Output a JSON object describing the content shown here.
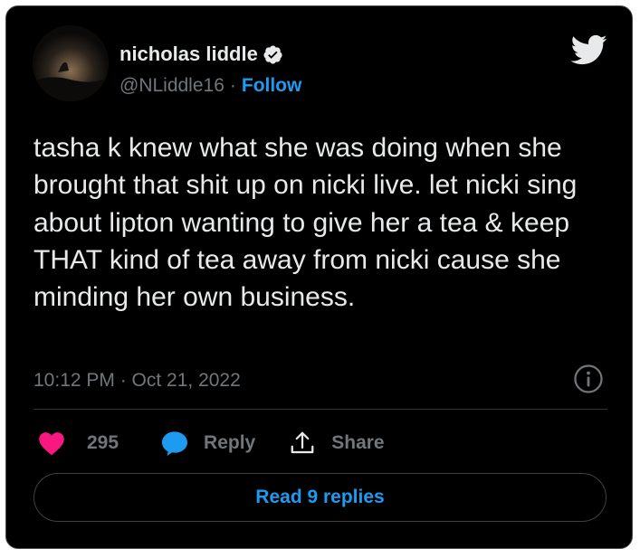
{
  "author": {
    "display_name": "nicholas liddle",
    "handle": "@NLiddle16",
    "separator": "·",
    "follow_label": "Follow",
    "verified": true
  },
  "tweet": {
    "text": "tasha k knew what she was doing when she brought that shit up on nicki live. let nicki sing about lipton wanting to give her a tea & keep THAT kind of tea away from nicki cause she minding her own business.",
    "timestamp": "10:12 PM · Oct 21, 2022"
  },
  "actions": {
    "like_count": "295",
    "reply_label": "Reply",
    "share_label": "Share"
  },
  "read_replies_label": "Read 9 replies",
  "icons": {
    "logo": "twitter-bird-icon",
    "verified": "verified-badge-icon",
    "info": "info-icon",
    "like": "heart-icon",
    "reply": "speech-bubble-icon",
    "share": "share-upload-icon"
  },
  "colors": {
    "background": "#000000",
    "text": "#e7e9ea",
    "muted": "#71767b",
    "accent": "#1d9bf0",
    "like": "#f91880"
  }
}
